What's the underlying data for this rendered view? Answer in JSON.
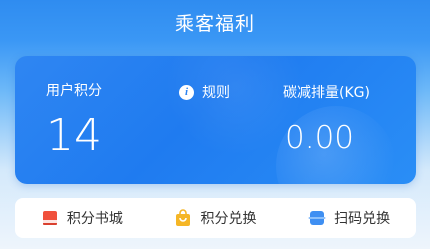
{
  "header": {
    "title": "乘客福利"
  },
  "summary": {
    "points_label": "用户积分",
    "points_value": "14",
    "rules_label": "规则",
    "carbon_label": "碳减排量(KG)",
    "carbon_value": "0.00"
  },
  "actions": [
    {
      "label": "积分书城",
      "icon": "book-icon",
      "color": "#f0503c"
    },
    {
      "label": "积分兑换",
      "icon": "shopping-bag-icon",
      "color": "#f5b626"
    },
    {
      "label": "扫码兑换",
      "icon": "scan-icon",
      "color": "#3f8ff2"
    }
  ]
}
